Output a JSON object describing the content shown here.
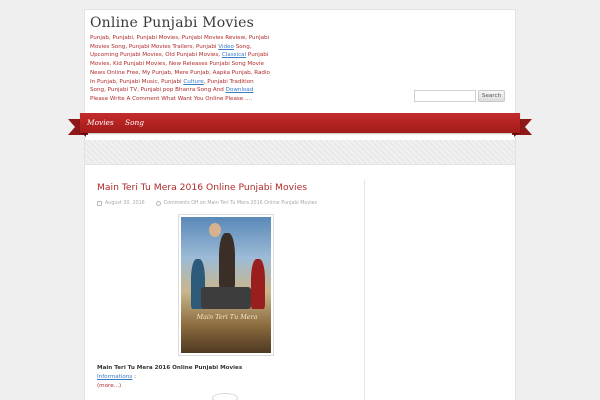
{
  "site": {
    "title": "Online Punjabi Movies",
    "description": {
      "part1": "Punjab, Punjabi, Punjabi Movies, Punjabi Movies Review, Punjabi Movies Song, Punjabi Movies Trailers, Punjabi ",
      "link1": "Video",
      "part2": " Song, Upcoming Punjabi Movies, Old Punjabi Movies, ",
      "link2": "Classical",
      "part3": " Punjabi Movies, Kid Punjabi Movies, New Releases Punjabi Song Movie News Online Free, My Punjab, Mere Punjab, Aapka Punjab, Radio In Punjab, Punjabi Music, Punjabi ",
      "link3": "Culture",
      "part4": ", Punjabi Tradition Song, Punjabi TV, Punjabi pop Bhanra Song And ",
      "link4": "Download",
      "part5": " Please Write A Comment What Want You Online Please ...."
    }
  },
  "search": {
    "placeholder": "",
    "button_label": "Search"
  },
  "nav": {
    "items": [
      {
        "label": "Movies"
      },
      {
        "label": "Song"
      }
    ]
  },
  "post": {
    "title": "Main Teri Tu Mera 2016 Online Punjabi Movies",
    "date": "August 30, 2016",
    "comments": "Comments Off on Main Teri Tu Mera 2016 Online Punjabi Movies",
    "poster_title": "Main Teri Tu Mera",
    "excerpt_bold": "Main Teri Tu Mera 2016 Online Punjabi Movies ",
    "excerpt_link": "Informations",
    "excerpt_tail": " :",
    "more_label": "(more...)"
  },
  "colors": {
    "accent": "#b02a2a",
    "nav_bg": "#b32222",
    "link": "#3a7bc8"
  }
}
